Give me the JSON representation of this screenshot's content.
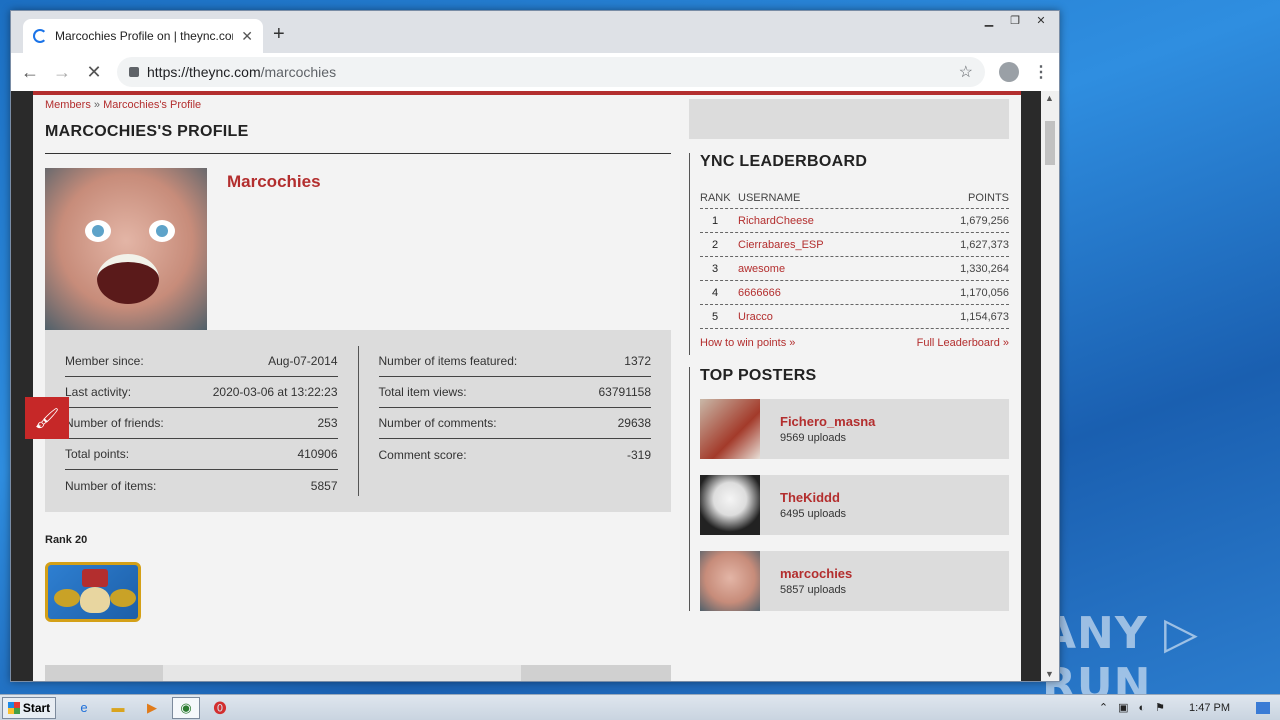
{
  "desktop": {
    "watermark": "ANY ▷ RUN"
  },
  "browser": {
    "tab_title": "Marcochies Profile on | theync.com",
    "url_main": "https://theync.com",
    "url_path": "/marcochies"
  },
  "page": {
    "breadcrumb": {
      "members": "Members",
      "separator": "»",
      "profile": "Marcochies's Profile"
    },
    "title": "MARCOCHIES'S PROFILE",
    "username": "Marcochies",
    "stats_left": [
      {
        "label": "Member since:",
        "value": "Aug-07-2014"
      },
      {
        "label": "Last activity:",
        "value": "2020-03-06 at 13:22:23"
      },
      {
        "label": "Number of friends:",
        "value": "253"
      },
      {
        "label": "Total points:",
        "value": "410906"
      },
      {
        "label": "Number of items:",
        "value": "5857"
      }
    ],
    "stats_right": [
      {
        "label": "Number of items featured:",
        "value": "1372"
      },
      {
        "label": "Total item views:",
        "value": "63791158"
      },
      {
        "label": "Number of comments:",
        "value": "29638"
      },
      {
        "label": "Comment score:",
        "value": "-319"
      }
    ],
    "rank_label": "Rank 20",
    "leaderboard": {
      "title": "YNC LEADERBOARD",
      "headers": {
        "rank": "RANK",
        "username": "USERNAME",
        "points": "POINTS"
      },
      "rows": [
        {
          "rank": "1",
          "username": "RichardCheese",
          "points": "1,679,256"
        },
        {
          "rank": "2",
          "username": "Cierrabares_ESP",
          "points": "1,627,373"
        },
        {
          "rank": "3",
          "username": "awesome",
          "points": "1,330,264"
        },
        {
          "rank": "4",
          "username": "6666666",
          "points": "1,170,056"
        },
        {
          "rank": "5",
          "username": "Uracco",
          "points": "1,154,673"
        }
      ],
      "how_to": "How to win points »",
      "full": "Full Leaderboard »"
    },
    "top_posters": {
      "title": "TOP POSTERS",
      "items": [
        {
          "name": "Fichero_masna",
          "uploads": "9569 uploads"
        },
        {
          "name": "TheKiddd",
          "uploads": "6495 uploads"
        },
        {
          "name": "marcochies",
          "uploads": "5857 uploads"
        }
      ]
    }
  },
  "taskbar": {
    "start": "Start",
    "time": "1:47 PM"
  }
}
